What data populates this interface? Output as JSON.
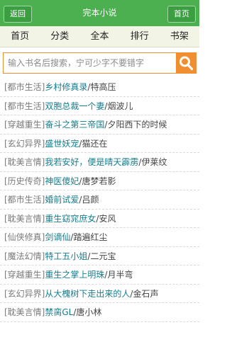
{
  "header": {
    "back_label": "返回",
    "title": "完本小说",
    "home_label": "首页"
  },
  "nav": [
    "首页",
    "分类",
    "全本",
    "排行",
    "书架"
  ],
  "search": {
    "placeholder": "输入书名后搜索，宁可少字不要错字"
  },
  "books": [
    {
      "category": "[都市生活]",
      "title": "乡村修真录",
      "author": "特高压"
    },
    {
      "category": "[都市生活]",
      "title": "双胞总裁一个妻",
      "author": "烟波儿"
    },
    {
      "category": "[穿越重生]",
      "title": "奋斗之第三帝国",
      "author": "夕阳西下的时候"
    },
    {
      "category": "[玄幻异界]",
      "title": "盛世妖宠",
      "author": "猫还在"
    },
    {
      "category": "[耽美言情]",
      "title": "我若安好，便是晴天霹雳",
      "author": "伊莱纹"
    },
    {
      "category": "[历史传奇]",
      "title": "神医傻妃",
      "author": "唐梦若影"
    },
    {
      "category": "[都市生活]",
      "title": "婚前试爱",
      "author": "吕颜"
    },
    {
      "category": "[耽美言情]",
      "title": "重生窈窕庶女",
      "author": "安风"
    },
    {
      "category": "[仙侠修真]",
      "title": "剑谪仙",
      "author": "踏遍红尘"
    },
    {
      "category": "[魔法幻情]",
      "title": "特工五小姐",
      "author": "二元宝"
    },
    {
      "category": "[穿越重生]",
      "title": "重生之掌上明珠",
      "author": "月半弯"
    },
    {
      "category": "[玄幻异界]",
      "title": "从大槐树下走出来的人",
      "author": "金石声"
    },
    {
      "category": "[耽美言情]",
      "title": "禁脔GL",
      "author": "唐小林"
    }
  ],
  "colors": {
    "header": "#4caf50",
    "accent_orange": "#f08f32",
    "title_link": "#137e8f"
  }
}
